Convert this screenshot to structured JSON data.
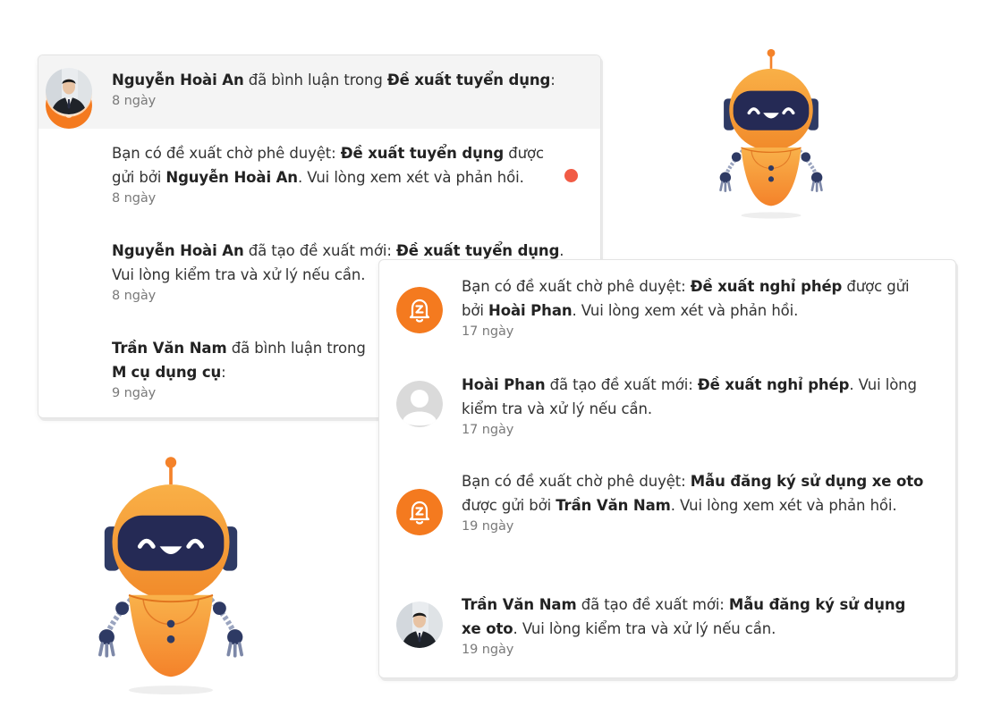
{
  "colors": {
    "accent": "#f47a1f",
    "unread_dot": "#f15b45",
    "highlight_row": "#f4f4f4",
    "text": "#333333",
    "time": "#7a7a7a"
  },
  "panel1": {
    "items": [
      {
        "avatar": "user-placeholder-icon",
        "parts": [
          {
            "t": "Nguyễn Hoài An",
            "b": true
          },
          {
            "t": " đã bình luận trong ",
            "b": false
          },
          {
            "t": "Đề xuất tuyển dụng",
            "b": true
          },
          {
            "t": ":",
            "b": false
          }
        ],
        "time": "8 ngày",
        "highlighted": true,
        "unread": false
      },
      {
        "avatar": "bell-icon",
        "parts": [
          {
            "t": "Bạn có đề xuất chờ phê duyệt: ",
            "b": false
          },
          {
            "t": "Đề xuất tuyển dụng",
            "b": true
          },
          {
            "t": " được gửi bởi ",
            "b": false
          },
          {
            "t": "Nguyễn Hoài An",
            "b": true
          },
          {
            "t": ". Vui lòng xem xét và phản hồi.",
            "b": false
          }
        ],
        "time": "8 ngày",
        "highlighted": false,
        "unread": true
      },
      {
        "avatar": "user-placeholder-icon",
        "parts": [
          {
            "t": "Nguyễn Hoài An",
            "b": true
          },
          {
            "t": " đã tạo đề xuất mới: ",
            "b": false
          },
          {
            "t": "Đề xuất tuyển dụng",
            "b": true
          },
          {
            "t": ". Vui lòng kiểm tra và xử lý nếu cần.",
            "b": false
          }
        ],
        "time": "8 ngày",
        "highlighted": false,
        "unread": false
      },
      {
        "avatar": "person-photo-avatar",
        "parts": [
          {
            "t": "Trần Văn Nam",
            "b": true
          },
          {
            "t": " đã bình luận trong ",
            "b": false
          },
          {
            "t": "M",
            "b": true
          },
          {
            "t": " ",
            "b": false
          },
          {
            "t": "cụ dụng cụ",
            "b": true
          },
          {
            "t": ":",
            "b": false
          }
        ],
        "time": "9 ngày",
        "highlighted": false,
        "unread": false
      }
    ]
  },
  "panel2": {
    "items": [
      {
        "avatar": "bell-icon",
        "parts": [
          {
            "t": "Bạn có đề xuất chờ phê duyệt: ",
            "b": false
          },
          {
            "t": "Đề xuất nghỉ phép",
            "b": true
          },
          {
            "t": " được gửi bởi ",
            "b": false
          },
          {
            "t": "Hoài Phan",
            "b": true
          },
          {
            "t": ". Vui lòng xem xét và phản hồi.",
            "b": false
          }
        ],
        "time": "17 ngày"
      },
      {
        "avatar": "gray-user-icon",
        "parts": [
          {
            "t": "Hoài Phan",
            "b": true
          },
          {
            "t": " đã tạo đề xuất mới: ",
            "b": false
          },
          {
            "t": "Đề xuất nghỉ phép",
            "b": true
          },
          {
            "t": ". Vui lòng kiểm tra và xử lý nếu cần.",
            "b": false
          }
        ],
        "time": "17 ngày"
      },
      {
        "avatar": "bell-icon",
        "parts": [
          {
            "t": "Bạn có đề xuất chờ phê duyệt: ",
            "b": false
          },
          {
            "t": "Mẫu đăng ký sử dụng xe oto",
            "b": true
          },
          {
            "t": " được gửi bởi ",
            "b": false
          },
          {
            "t": "Trần Văn Nam",
            "b": true
          },
          {
            "t": ". Vui lòng xem xét và phản hồi.",
            "b": false
          }
        ],
        "time": "19 ngày"
      },
      {
        "avatar": "person-photo-avatar",
        "parts": [
          {
            "t": "Trần Văn Nam",
            "b": true
          },
          {
            "t": " đã tạo đề xuất mới: ",
            "b": false
          },
          {
            "t": "Mẫu đăng ký sử dụng xe oto",
            "b": true
          },
          {
            "t": ". Vui lòng kiểm tra và xử lý nếu cần.",
            "b": false
          }
        ],
        "time": "19 ngày"
      }
    ]
  },
  "decorations": {
    "robot_icon": "robot-mascot-icon"
  }
}
